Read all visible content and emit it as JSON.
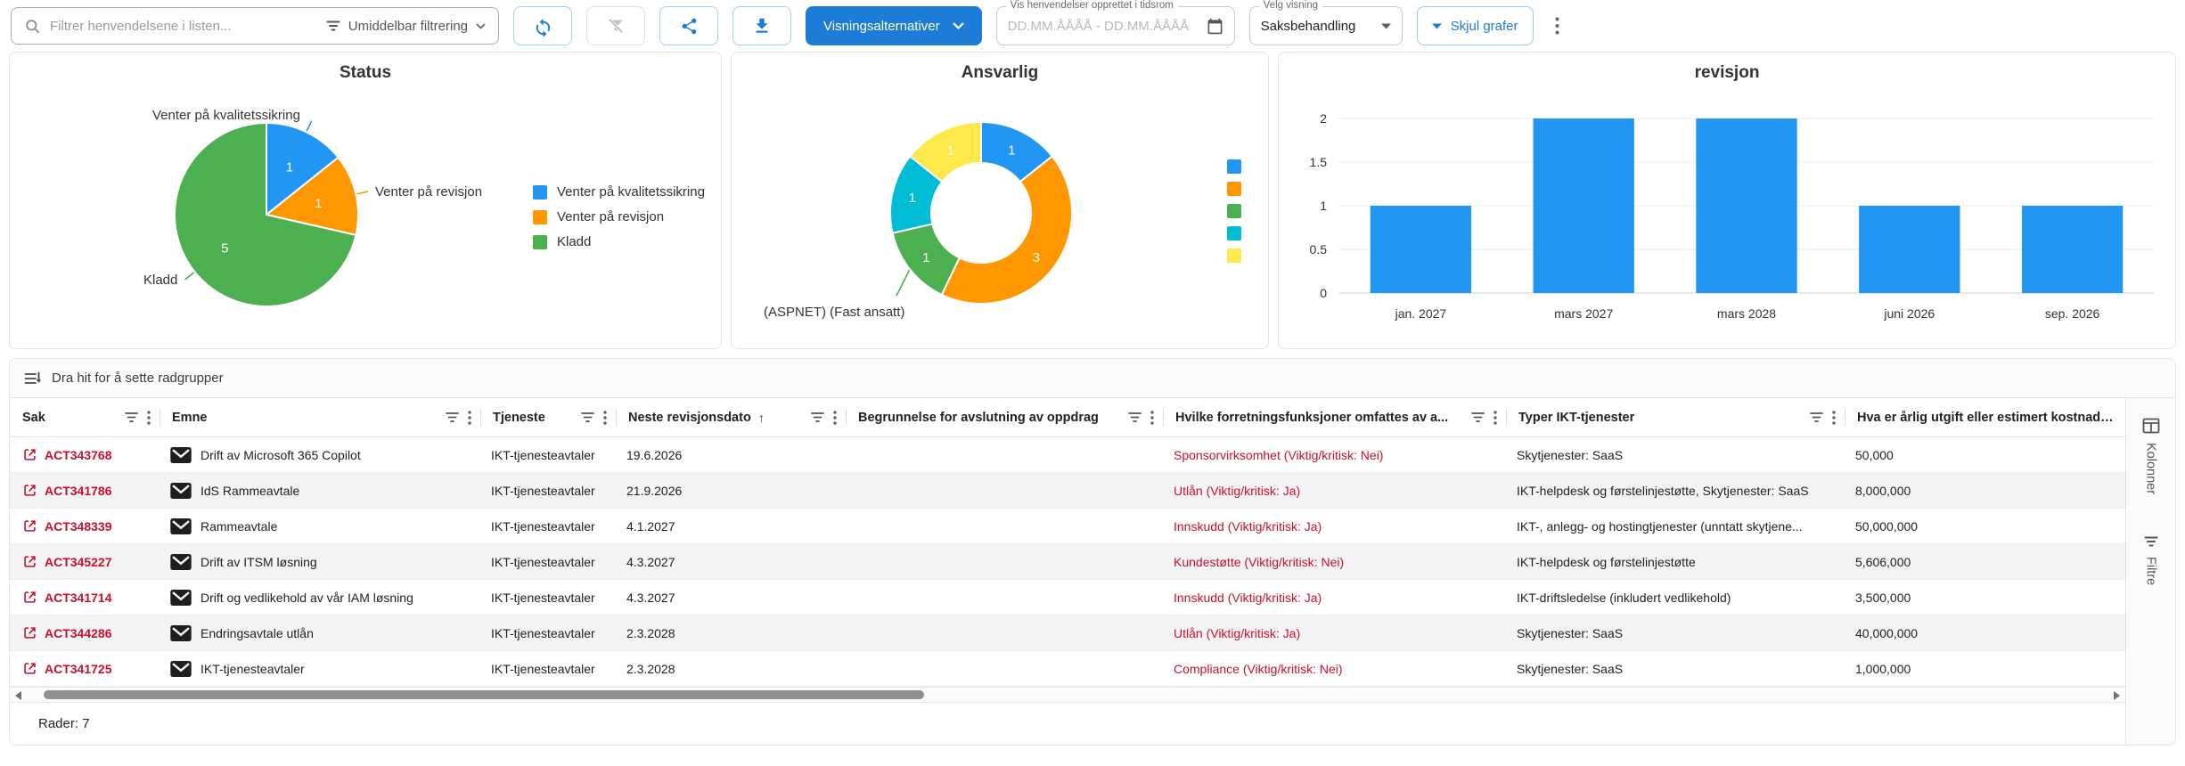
{
  "toolbar": {
    "search_placeholder": "Filtrer henvendelsene i listen...",
    "filter_mode": "Umiddelbar filtrering",
    "view_options_button": "Visningsalternativer",
    "date_range_label": "Vis henvendelser opprettet i tidsrom",
    "date_range_placeholder": "DD.MM.ÅÅÅÅ - DD.MM.ÅÅÅÅ",
    "view_select_label": "Velg visning",
    "view_select_value": "Saksbehandling",
    "hide_charts_button": "Skjul grafer"
  },
  "chart_data": [
    {
      "type": "pie",
      "title": "Status",
      "labels": [
        "Venter på kvalitetssikring",
        "Venter på revisjon",
        "Kladd"
      ],
      "values": [
        1,
        1,
        5
      ],
      "colors": [
        "#2196f3",
        "#ff9800",
        "#4caf50"
      ],
      "legend_position": "right"
    },
    {
      "type": "pie",
      "subtype": "donut",
      "title": "Ansvarlig",
      "labels": [
        "",
        "",
        "(ASPNET) (Fast ansatt)",
        "",
        ""
      ],
      "legend_labels": [
        "",
        "",
        "",
        "",
        ""
      ],
      "values": [
        1,
        3,
        1,
        1,
        1
      ],
      "colors": [
        "#2196f3",
        "#ff9800",
        "#4caf50",
        "#00bcd4",
        "#ffe94a"
      ],
      "legend_position": "right"
    },
    {
      "type": "bar",
      "title": "revisjon",
      "categories": [
        "jan. 2027",
        "mars 2027",
        "mars 2028",
        "juni 2026",
        "sep. 2026"
      ],
      "values": [
        1,
        2,
        2,
        1,
        1
      ],
      "xlabel": "",
      "ylabel": "",
      "ylim": [
        0,
        2
      ],
      "yticks": [
        0,
        0.5,
        1,
        1.5,
        2
      ],
      "grid": true,
      "bar_color": "#2196f3"
    }
  ],
  "table": {
    "drag_hint": "Dra hit for å sette radgrupper",
    "columns": [
      {
        "label": "Sak"
      },
      {
        "label": "Emne"
      },
      {
        "label": "Tjeneste"
      },
      {
        "label": "Neste revisjonsdato",
        "sort": "↑"
      },
      {
        "label": "Begrunnelse for avslutning av oppdrag"
      },
      {
        "label": "Hvilke forretningsfunksjoner omfattes av a..."
      },
      {
        "label": "Typer IKT-tjenester"
      },
      {
        "label": "Hva er årlig utgift eller estimert kostnad i l..."
      }
    ],
    "rows": [
      {
        "sak": "ACT343768",
        "emne": "Drift av Microsoft 365 Copilot",
        "tjeneste": "IKT-tjenesteavtaler",
        "neste_revisjonsdato": "19.6.2026",
        "begrunnelse": "",
        "forretningsfunksjoner": "Sponsorvirksomhet (Viktig/kritisk: Nei)",
        "typer_ikt": "Skytjenester: SaaS",
        "arlig_utgift": "50,000"
      },
      {
        "sak": "ACT341786",
        "emne": "IdS Rammeavtale",
        "tjeneste": "IKT-tjenesteavtaler",
        "neste_revisjonsdato": "21.9.2026",
        "begrunnelse": "",
        "forretningsfunksjoner": "Utlån (Viktig/kritisk: Ja)",
        "typer_ikt": "IKT-helpdesk og førstelinjestøtte, Skytjenester: SaaS",
        "arlig_utgift": "8,000,000"
      },
      {
        "sak": "ACT348339",
        "emne": "Rammeavtale",
        "tjeneste": "IKT-tjenesteavtaler",
        "neste_revisjonsdato": "4.1.2027",
        "begrunnelse": "",
        "forretningsfunksjoner": "Innskudd (Viktig/kritisk: Ja)",
        "typer_ikt": "IKT-, anlegg- og hostingtjenester (unntatt skytjene...",
        "arlig_utgift": "50,000,000"
      },
      {
        "sak": "ACT345227",
        "emne": "Drift av ITSM løsning",
        "tjeneste": "IKT-tjenesteavtaler",
        "neste_revisjonsdato": "4.3.2027",
        "begrunnelse": "",
        "forretningsfunksjoner": "Kundestøtte (Viktig/kritisk: Nei)",
        "typer_ikt": "IKT-helpdesk og førstelinjestøtte",
        "arlig_utgift": "5,606,000"
      },
      {
        "sak": "ACT341714",
        "emne": "Drift og vedlikehold av vår IAM løsning",
        "tjeneste": "IKT-tjenesteavtaler",
        "neste_revisjonsdato": "4.3.2027",
        "begrunnelse": "",
        "forretningsfunksjoner": "Innskudd (Viktig/kritisk: Ja)",
        "typer_ikt": "IKT-driftsledelse (inkludert vedlikehold)",
        "arlig_utgift": "3,500,000"
      },
      {
        "sak": "ACT344286",
        "emne": "Endringsavtale utlån",
        "tjeneste": "IKT-tjenesteavtaler",
        "neste_revisjonsdato": "2.3.2028",
        "begrunnelse": "",
        "forretningsfunksjoner": "Utlån (Viktig/kritisk: Ja)",
        "typer_ikt": "Skytjenester: SaaS",
        "arlig_utgift": "40,000,000"
      },
      {
        "sak": "ACT341725",
        "emne": "IKT-tjenesteavtaler",
        "tjeneste": "IKT-tjenesteavtaler",
        "neste_revisjonsdato": "2.3.2028",
        "begrunnelse": "",
        "forretningsfunksjoner": "Compliance (Viktig/kritisk: Nei)",
        "typer_ikt": "Skytjenester: SaaS",
        "arlig_utgift": "1,000,000"
      }
    ],
    "row_count_label": "Rader: 7",
    "side_tabs": [
      {
        "label": "Kolonner"
      },
      {
        "label": "Filtre"
      }
    ]
  },
  "colors": {
    "accent_blue": "#1c7cd8",
    "chart_blue": "#2196f3",
    "chart_orange": "#ff9800",
    "chart_green": "#4caf50",
    "chart_teal": "#00bcd4",
    "chart_yellow": "#ffe94a",
    "link_red": "#c8102e"
  }
}
